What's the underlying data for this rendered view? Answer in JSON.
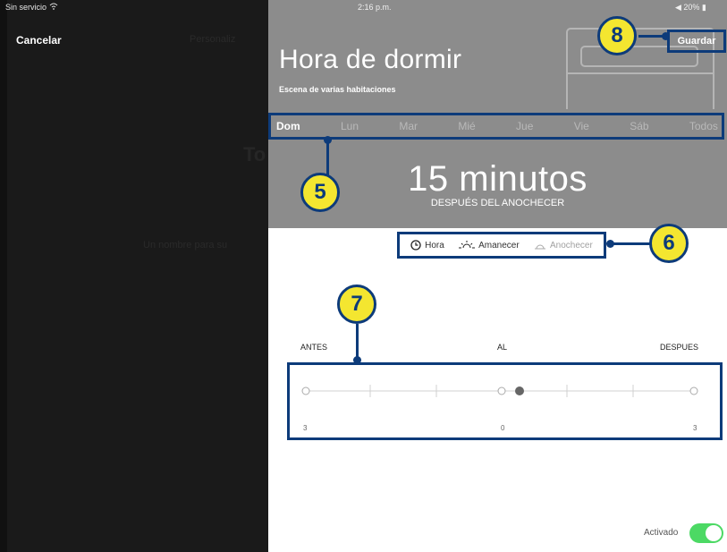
{
  "status": {
    "carrier": "Sin servicio",
    "time": "2:16 p.m.",
    "battery": "◀ 20% ▮"
  },
  "left": {
    "cancel": "Cancelar",
    "ghost_header": "Personaliz",
    "ghost_title": "To",
    "ghost_text": "Un nombre para su"
  },
  "header": {
    "title": "Hora de dormir",
    "subtitle": "Escena de varias habitaciones",
    "save": "Guardar"
  },
  "days": [
    {
      "label": "Dom",
      "active": true
    },
    {
      "label": "Lun",
      "active": false
    },
    {
      "label": "Mar",
      "active": false
    },
    {
      "label": "Mié",
      "active": false
    },
    {
      "label": "Jue",
      "active": false
    },
    {
      "label": "Vie",
      "active": false
    },
    {
      "label": "Sáb",
      "active": false
    },
    {
      "label": "Todos",
      "active": false
    }
  ],
  "offset": {
    "value": "15 minutos",
    "caption": "DESPUÉS DEL ANOCHECER"
  },
  "modes": [
    {
      "label": "Hora",
      "icon": "clock-icon"
    },
    {
      "label": "Amanecer",
      "icon": "sunrise-icon"
    },
    {
      "label": "Anochecer",
      "icon": "sunset-icon"
    }
  ],
  "slider": {
    "left_label": "ANTES",
    "center_label": "AL",
    "right_label": "DESPUES",
    "tick_left": "3",
    "tick_center": "0",
    "tick_right": "3"
  },
  "toggle": {
    "label": "Activado",
    "on": true
  },
  "callouts": {
    "c5": "5",
    "c6": "6",
    "c7": "7",
    "c8": "8"
  },
  "colors": {
    "accent": "#0d3b7a",
    "callout": "#f4e630",
    "header": "#8c8c8c",
    "toggle_on": "#4cd964"
  }
}
